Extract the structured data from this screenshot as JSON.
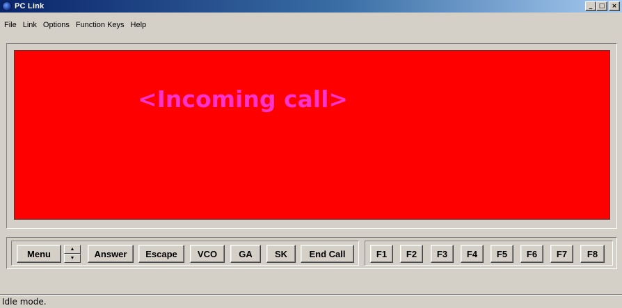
{
  "window": {
    "title": "PC Link",
    "minimize_glyph": "_",
    "maximize_glyph": "□",
    "close_glyph": "×"
  },
  "menu": [
    "File",
    "Link",
    "Options",
    "Function Keys",
    "Help"
  ],
  "display": {
    "message": "<Incoming call>",
    "background_color": "#ff0000",
    "text_color": "#ff33cc"
  },
  "controls": {
    "menu_label": "Menu",
    "answer_label": "Answer",
    "escape_label": "Escape",
    "vco_label": "VCO",
    "ga_label": "GA",
    "sk_label": "SK",
    "end_call_label": "End Call"
  },
  "function_keys": [
    "F1",
    "F2",
    "F3",
    "F4",
    "F5",
    "F6",
    "F7",
    "F8"
  ],
  "status": {
    "text": "Idle mode."
  }
}
